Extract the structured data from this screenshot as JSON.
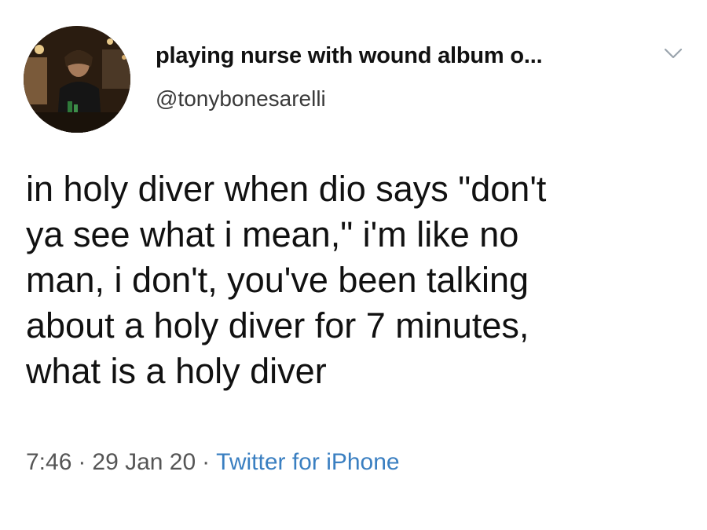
{
  "tweet": {
    "display_name": "playing nurse with wound album o...",
    "handle": "@tonybonesarelli",
    "text_lines": [
      "in holy diver when dio says \"don't",
      "ya see what i mean,\" i'm like no",
      "man, i don't, you've been talking",
      "about a holy diver for 7 minutes,",
      "what is a holy diver"
    ],
    "time": "7:46",
    "date": "29 Jan 20",
    "source": "Twitter for iPhone",
    "separator": "·"
  },
  "icons": {
    "menu": "chevron-down-icon"
  },
  "colors": {
    "text": "#111111",
    "handle": "#3a3a3a",
    "meta": "#555555",
    "source_link": "#3a7fc1"
  }
}
